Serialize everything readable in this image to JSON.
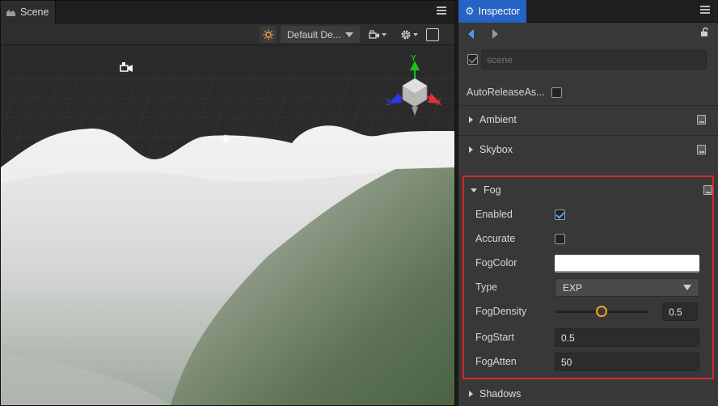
{
  "scene_panel": {
    "tab_label": "Scene",
    "toolbar": {
      "sun_icon": "sun-icon",
      "env_select": "Default De...",
      "camera_icon": "camera-icon",
      "settings_icon": "gear-icon",
      "layout_icon": "layout-icon"
    },
    "gizmo": {
      "x": "X",
      "y": "Y",
      "z": "Z"
    }
  },
  "inspector": {
    "tab_label": "Inspector",
    "node_name_placeholder": "scene",
    "node_enabled": true,
    "auto_release_label": "AutoReleaseAs...",
    "auto_release_checked": false,
    "sections": {
      "ambient": "Ambient",
      "skybox": "Skybox",
      "fog": "Fog",
      "shadows": "Shadows"
    },
    "fog": {
      "enabled_label": "Enabled",
      "enabled": true,
      "accurate_label": "Accurate",
      "accurate": false,
      "fog_color_label": "FogColor",
      "fog_color": "#ffffff",
      "type_label": "Type",
      "type_value": "EXP",
      "fog_density_label": "FogDensity",
      "fog_density_value": "0.5",
      "fog_density_fraction": 0.5,
      "fog_start_label": "FogStart",
      "fog_start_value": "0.5",
      "fog_atten_label": "FogAtten",
      "fog_atten_value": "50"
    }
  },
  "colors": {
    "accent": "#2563c4",
    "highlight_border": "#d6262b",
    "slider_thumb": "#f0a41e"
  }
}
